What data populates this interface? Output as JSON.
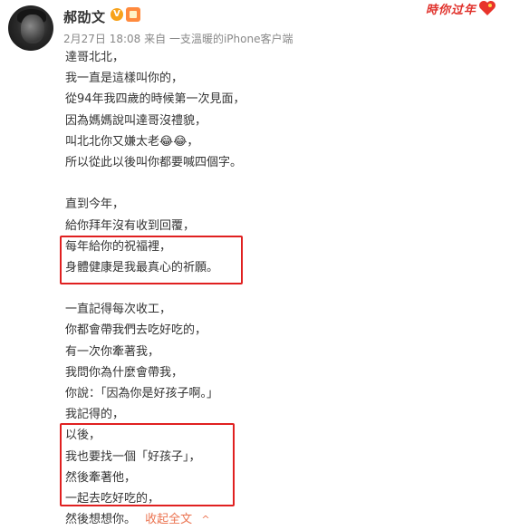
{
  "user": {
    "name": "郝劭文",
    "verified_badge": "V"
  },
  "meta": {
    "time": "2月27日 18:08",
    "source": "来自 一支溫暖的iPhone客户端"
  },
  "badge": {
    "new_year": "時你过年"
  },
  "post": {
    "lines": [
      "達哥北北，",
      "我一直是這樣叫你的，",
      "從94年我四歲的時候第一次見面，",
      "因為媽媽說叫達哥沒禮貌，",
      "叫北北你又嫌太老😂😂，",
      "所以從此以後叫你都要喊四個字。",
      "",
      "直到今年，",
      "給你拜年沒有收到回覆，",
      "每年給你的祝福裡，",
      "身體健康是我最真心的祈願。",
      "",
      "一直記得每次收工，",
      "你都會帶我們去吃好吃的，",
      "有一次你牽著我，",
      "我問你為什麼會帶我，",
      "你說：「因為你是好孩子啊。」",
      "我記得的，",
      "以後，",
      "我也要找一個「好孩子」，",
      "然後牽著他，",
      "一起去吃好吃的，"
    ],
    "last_line": "然後想想你。",
    "collapse_label": "收起全文",
    "collapse_icon": "^"
  },
  "colors": {
    "highlight": "#e02020",
    "link": "#eb7350",
    "meta": "#888888"
  }
}
